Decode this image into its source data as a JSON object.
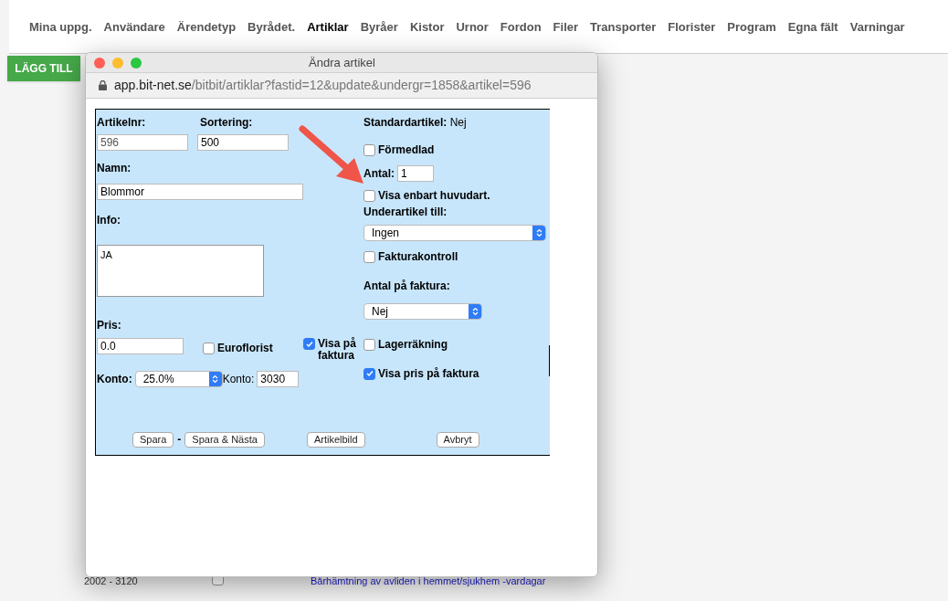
{
  "nav": [
    {
      "label": "Mina uppg.",
      "selected": false
    },
    {
      "label": "Användare",
      "selected": false
    },
    {
      "label": "Ärendetyp",
      "selected": false
    },
    {
      "label": "Byrådet.",
      "selected": false
    },
    {
      "label": "Artiklar",
      "selected": true
    },
    {
      "label": "Byråer",
      "selected": false
    },
    {
      "label": "Kistor",
      "selected": false
    },
    {
      "label": "Urnor",
      "selected": false
    },
    {
      "label": "Fordon",
      "selected": false
    },
    {
      "label": "Filer",
      "selected": false
    },
    {
      "label": "Transporter",
      "selected": false
    },
    {
      "label": "Florister",
      "selected": false
    },
    {
      "label": "Program",
      "selected": false
    },
    {
      "label": "Egna fält",
      "selected": false
    },
    {
      "label": "Varningar",
      "selected": false
    }
  ],
  "add_button": "LÄGG TILL",
  "dialog": {
    "title": "Ändra artikel",
    "url_host": "app.bit-net.se",
    "url_path": "/bitbit/artiklar?fastid=12&update&undergr=1858&artikel=596",
    "form": {
      "artikelnr": {
        "label": "Artikelnr:",
        "value": "596"
      },
      "sortering": {
        "label": "Sortering:",
        "value": "500"
      },
      "namn": {
        "label": "Namn:",
        "value": "Blommor"
      },
      "info": {
        "label": "Info:",
        "value": "JA"
      },
      "pris": {
        "label": "Pris:",
        "value": "0.0"
      },
      "euroflorist": {
        "label": "Euroflorist",
        "checked": false
      },
      "visa_pa_faktura": {
        "label": "Visa på faktura",
        "checked": true
      },
      "konto_vat": {
        "label": "Konto:",
        "value": "25.0%"
      },
      "konto": {
        "label": "Konto:",
        "value": "3030"
      },
      "standardartikel": {
        "label": "Standardartikel:",
        "value": "Nej"
      },
      "formedlad": {
        "label": "Förmedlad",
        "checked": false
      },
      "antal": {
        "label": "Antal:",
        "value": "1"
      },
      "visa_enbart": {
        "label": "Visa enbart huvudart.",
        "checked": false
      },
      "underartikel": {
        "label": "Underartikel till:",
        "value": "Ingen"
      },
      "fakturakontroll": {
        "label": "Fakturakontroll",
        "checked": false
      },
      "antal_faktura": {
        "label": "Antal på faktura:",
        "value": "Nej"
      },
      "lagerrakning": {
        "label": "Lagerräkning",
        "checked": false
      },
      "visa_pris": {
        "label": "Visa pris på faktura",
        "checked": true
      },
      "buttons": [
        "Spara",
        "-",
        "Spara & Nästa",
        "Artikelbild",
        "Avbryt"
      ]
    }
  },
  "background_rows": [
    {
      "number": "2002 - 3120",
      "checked": false,
      "link": "Bårhämtning av avliden i hemmet/sjukhem -vardagar"
    }
  ]
}
